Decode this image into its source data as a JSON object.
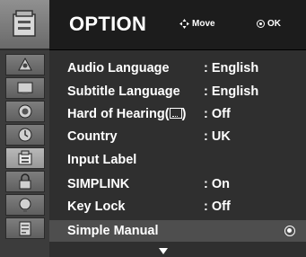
{
  "header": {
    "title": "OPTION",
    "move_label": "Move",
    "ok_label": "OK"
  },
  "menu": {
    "items": [
      {
        "label": "Audio Language",
        "value": ": English"
      },
      {
        "label": "Subtitle Language",
        "value": ": English"
      },
      {
        "label": "Hard of Hearing(",
        "value": ": Off"
      },
      {
        "label": "Country",
        "value": ": UK"
      },
      {
        "label": "Input Label",
        "value": ""
      },
      {
        "label": "SIMPLINK",
        "value": ": On"
      },
      {
        "label": "Key Lock",
        "value": ": Off"
      },
      {
        "label": "Simple Manual",
        "value": ""
      }
    ],
    "hoh_suffix": ")",
    "selected_index": 7
  },
  "sidebar": {
    "header_icon": "option-toolbox-icon",
    "icons": [
      "setup-icon",
      "picture-icon",
      "audio-icon",
      "time-icon",
      "option-icon",
      "lock-icon",
      "usb-icon",
      "document-icon"
    ],
    "active_index": 4
  },
  "colors": {
    "menu_bg": "#2f2f2f",
    "header_bg": "#1c1c1c",
    "selected_bg": "#4e4e4e",
    "text": "#ffffff"
  }
}
